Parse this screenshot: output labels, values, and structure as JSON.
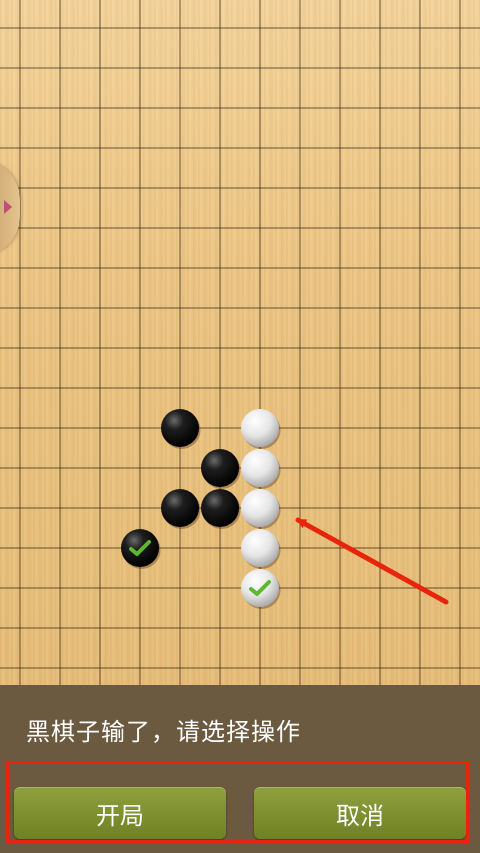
{
  "board": {
    "background_color": "#ebc584",
    "grid_color": "#3a2a14",
    "black_stones": [
      [
        4,
        10
      ],
      [
        5,
        11
      ],
      [
        4,
        12
      ],
      [
        5,
        12
      ]
    ],
    "white_stones": [
      [
        6,
        10
      ],
      [
        6,
        11
      ],
      [
        6,
        12
      ],
      [
        6,
        13
      ]
    ],
    "marked_black_stone": [
      3,
      13
    ],
    "marked_white_stone": [
      6,
      14
    ],
    "marker_icon": "checkmark-icon",
    "marker_color": "#5cb82e"
  },
  "annotation": {
    "arrow_color": "#e8240c",
    "box_color": "#e8240c"
  },
  "dialog": {
    "message": "黑棋子输了，请选择操作",
    "background_color": "#6b5a3f",
    "buttons": {
      "start_label": "开局",
      "cancel_label": "取消"
    },
    "button_color": "#7d8f2f"
  },
  "side_tab": {
    "icon": "chevron-right-icon"
  }
}
